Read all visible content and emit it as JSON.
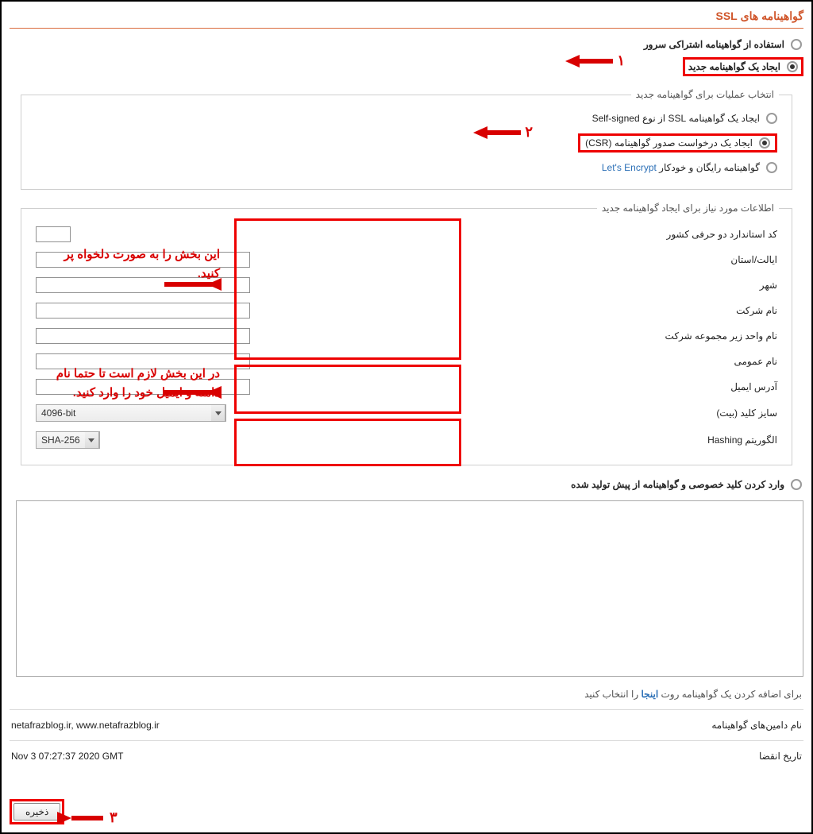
{
  "page_title": "گواهینامه های SSL",
  "options": {
    "shared_cert": "استفاده از گواهینامه اشتراکی سرور",
    "new_cert": "ایجاد یک گواهینامه جدید",
    "pregenerated": "وارد کردن کلید خصوصی و گواهینامه از پیش تولید شده"
  },
  "fieldset1": {
    "legend": "انتخاب عملیات برای گواهینامه جدید",
    "self_signed": "ایجاد یک گواهینامه SSL از نوع Self-signed",
    "csr": "ایجاد یک درخواست صدور گواهینامه (CSR)",
    "lets_encrypt_prefix": "گواهینامه رایگان و خودکار ",
    "lets_encrypt_link": "Let's Encrypt"
  },
  "fieldset2": {
    "legend": "اطلاعات مورد نیاز برای ایجاد گواهینامه جدید",
    "labels": {
      "country": "کد استاندارد دو حرفی کشور",
      "state": "ایالت/استان",
      "city": "شهر",
      "company": "نام شرکت",
      "unit": "نام واحد زیر مجموعه شرکت",
      "common_name": "نام عمومی",
      "email": "آدرس ایمیل",
      "key_size": "سایز کلید (بیت)",
      "hashing": "الگوریتم Hashing"
    },
    "key_size_value": "4096-bit",
    "hashing_value": "SHA-256"
  },
  "annotations": {
    "n1": "۱",
    "n2": "۲",
    "n3": "۳",
    "note1": "این بخش را به صورت دلخواه پر کنید.",
    "note2": "در این بخش لازم است تا حتما نام دامنه و ایمیل خود را وارد کنید."
  },
  "hint": {
    "prefix": "برای اضافه کردن یک گواهینامه روت ",
    "link": "اینجا",
    "suffix": " را انتخاب کنید"
  },
  "kv": {
    "domains_label": "نام دامین‌های گواهینامه",
    "domains_value": "netafrazblog.ir, www.netafrazblog.ir",
    "expiry_label": "تاریخ انقضا",
    "expiry_value": "Nov 3 07:27:37 2020 GMT"
  },
  "save_label": "ذخیره"
}
